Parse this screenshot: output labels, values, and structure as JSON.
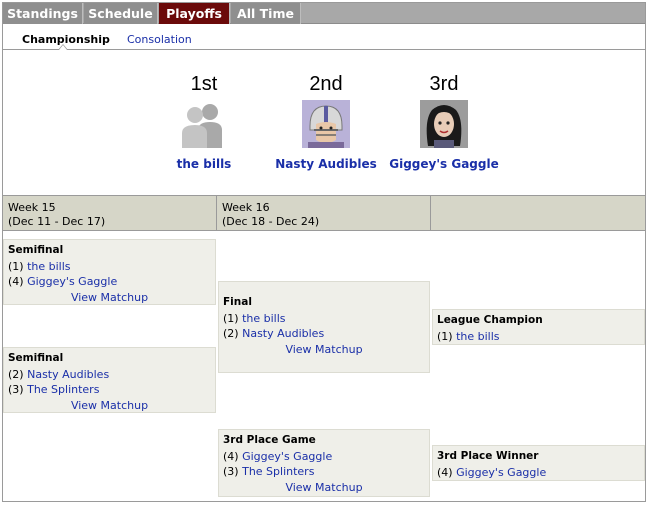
{
  "tabs": [
    {
      "label": "Standings"
    },
    {
      "label": "Schedule"
    },
    {
      "label": "Playoffs"
    },
    {
      "label": "All Time"
    }
  ],
  "subtabs": [
    {
      "label": "Championship"
    },
    {
      "label": "Consolation"
    }
  ],
  "podium": [
    {
      "place": "1st",
      "team": "the bills",
      "avatar": "silhouette-icon"
    },
    {
      "place": "2nd",
      "team": "Nasty Audibles",
      "avatar": "helmet-avatar"
    },
    {
      "place": "3rd",
      "team": "Giggey's Gaggle",
      "avatar": "girl-avatar"
    }
  ],
  "weeks": [
    {
      "label": "Week 15",
      "range": "(Dec 11 - Dec 17)"
    },
    {
      "label": "Week 16",
      "range": "(Dec 18 - Dec 24)"
    }
  ],
  "matchups": {
    "semi1": {
      "title": "Semifinal",
      "lines": [
        {
          "seed": "(1)",
          "team": "the bills"
        },
        {
          "seed": "(4)",
          "team": "Giggey's Gaggle"
        }
      ],
      "view": "View Matchup"
    },
    "semi2": {
      "title": "Semifinal",
      "lines": [
        {
          "seed": "(2)",
          "team": "Nasty Audibles"
        },
        {
          "seed": "(3)",
          "team": "The Splinters"
        }
      ],
      "view": "View Matchup"
    },
    "final": {
      "title": "Final",
      "lines": [
        {
          "seed": "(1)",
          "team": "the bills"
        },
        {
          "seed": "(2)",
          "team": "Nasty Audibles"
        }
      ],
      "view": "View Matchup"
    },
    "third": {
      "title": "3rd Place Game",
      "lines": [
        {
          "seed": "(4)",
          "team": "Giggey's Gaggle"
        },
        {
          "seed": "(3)",
          "team": "The Splinters"
        }
      ],
      "view": "View Matchup"
    },
    "champ": {
      "title": "League Champion",
      "lines": [
        {
          "seed": "(1)",
          "team": "the bills"
        }
      ]
    },
    "thirdwin": {
      "title": "3rd Place Winner",
      "lines": [
        {
          "seed": "(4)",
          "team": "Giggey's Gaggle"
        }
      ]
    }
  },
  "colors": {
    "active_tab": "#6b0a0a",
    "tab": "#8f8f8f",
    "link": "#1a2fa8",
    "week_header": "#d6d6c8",
    "box": "#efefe9"
  }
}
